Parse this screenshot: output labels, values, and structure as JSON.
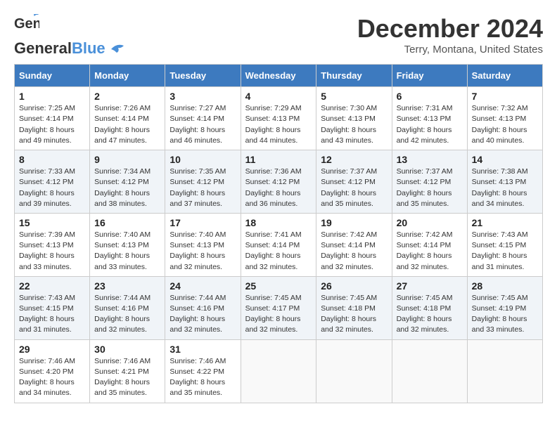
{
  "header": {
    "logo_general": "General",
    "logo_blue": "Blue",
    "month": "December 2024",
    "location": "Terry, Montana, United States"
  },
  "days_of_week": [
    "Sunday",
    "Monday",
    "Tuesday",
    "Wednesday",
    "Thursday",
    "Friday",
    "Saturday"
  ],
  "weeks": [
    [
      {
        "day": "1",
        "sunrise": "7:25 AM",
        "sunset": "4:14 PM",
        "daylight": "8 hours and 49 minutes."
      },
      {
        "day": "2",
        "sunrise": "7:26 AM",
        "sunset": "4:14 PM",
        "daylight": "8 hours and 47 minutes."
      },
      {
        "day": "3",
        "sunrise": "7:27 AM",
        "sunset": "4:14 PM",
        "daylight": "8 hours and 46 minutes."
      },
      {
        "day": "4",
        "sunrise": "7:29 AM",
        "sunset": "4:13 PM",
        "daylight": "8 hours and 44 minutes."
      },
      {
        "day": "5",
        "sunrise": "7:30 AM",
        "sunset": "4:13 PM",
        "daylight": "8 hours and 43 minutes."
      },
      {
        "day": "6",
        "sunrise": "7:31 AM",
        "sunset": "4:13 PM",
        "daylight": "8 hours and 42 minutes."
      },
      {
        "day": "7",
        "sunrise": "7:32 AM",
        "sunset": "4:13 PM",
        "daylight": "8 hours and 40 minutes."
      }
    ],
    [
      {
        "day": "8",
        "sunrise": "7:33 AM",
        "sunset": "4:12 PM",
        "daylight": "8 hours and 39 minutes."
      },
      {
        "day": "9",
        "sunrise": "7:34 AM",
        "sunset": "4:12 PM",
        "daylight": "8 hours and 38 minutes."
      },
      {
        "day": "10",
        "sunrise": "7:35 AM",
        "sunset": "4:12 PM",
        "daylight": "8 hours and 37 minutes."
      },
      {
        "day": "11",
        "sunrise": "7:36 AM",
        "sunset": "4:12 PM",
        "daylight": "8 hours and 36 minutes."
      },
      {
        "day": "12",
        "sunrise": "7:37 AM",
        "sunset": "4:12 PM",
        "daylight": "8 hours and 35 minutes."
      },
      {
        "day": "13",
        "sunrise": "7:37 AM",
        "sunset": "4:12 PM",
        "daylight": "8 hours and 35 minutes."
      },
      {
        "day": "14",
        "sunrise": "7:38 AM",
        "sunset": "4:13 PM",
        "daylight": "8 hours and 34 minutes."
      }
    ],
    [
      {
        "day": "15",
        "sunrise": "7:39 AM",
        "sunset": "4:13 PM",
        "daylight": "8 hours and 33 minutes."
      },
      {
        "day": "16",
        "sunrise": "7:40 AM",
        "sunset": "4:13 PM",
        "daylight": "8 hours and 33 minutes."
      },
      {
        "day": "17",
        "sunrise": "7:40 AM",
        "sunset": "4:13 PM",
        "daylight": "8 hours and 32 minutes."
      },
      {
        "day": "18",
        "sunrise": "7:41 AM",
        "sunset": "4:14 PM",
        "daylight": "8 hours and 32 minutes."
      },
      {
        "day": "19",
        "sunrise": "7:42 AM",
        "sunset": "4:14 PM",
        "daylight": "8 hours and 32 minutes."
      },
      {
        "day": "20",
        "sunrise": "7:42 AM",
        "sunset": "4:14 PM",
        "daylight": "8 hours and 32 minutes."
      },
      {
        "day": "21",
        "sunrise": "7:43 AM",
        "sunset": "4:15 PM",
        "daylight": "8 hours and 31 minutes."
      }
    ],
    [
      {
        "day": "22",
        "sunrise": "7:43 AM",
        "sunset": "4:15 PM",
        "daylight": "8 hours and 31 minutes."
      },
      {
        "day": "23",
        "sunrise": "7:44 AM",
        "sunset": "4:16 PM",
        "daylight": "8 hours and 32 minutes."
      },
      {
        "day": "24",
        "sunrise": "7:44 AM",
        "sunset": "4:16 PM",
        "daylight": "8 hours and 32 minutes."
      },
      {
        "day": "25",
        "sunrise": "7:45 AM",
        "sunset": "4:17 PM",
        "daylight": "8 hours and 32 minutes."
      },
      {
        "day": "26",
        "sunrise": "7:45 AM",
        "sunset": "4:18 PM",
        "daylight": "8 hours and 32 minutes."
      },
      {
        "day": "27",
        "sunrise": "7:45 AM",
        "sunset": "4:18 PM",
        "daylight": "8 hours and 32 minutes."
      },
      {
        "day": "28",
        "sunrise": "7:45 AM",
        "sunset": "4:19 PM",
        "daylight": "8 hours and 33 minutes."
      }
    ],
    [
      {
        "day": "29",
        "sunrise": "7:46 AM",
        "sunset": "4:20 PM",
        "daylight": "8 hours and 34 minutes."
      },
      {
        "day": "30",
        "sunrise": "7:46 AM",
        "sunset": "4:21 PM",
        "daylight": "8 hours and 35 minutes."
      },
      {
        "day": "31",
        "sunrise": "7:46 AM",
        "sunset": "4:22 PM",
        "daylight": "8 hours and 35 minutes."
      },
      null,
      null,
      null,
      null
    ]
  ]
}
